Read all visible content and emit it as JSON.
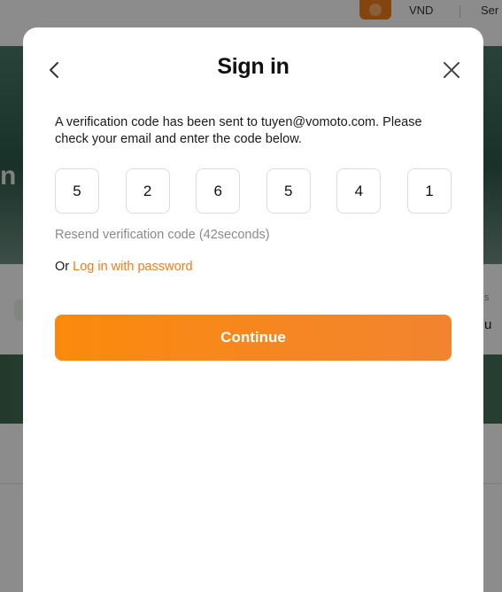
{
  "background": {
    "currency": "VND",
    "trailing_text": "Ser",
    "hero_glyph": "n",
    "right_small": "s",
    "right_text": "u"
  },
  "modal": {
    "title": "Sign in",
    "back_icon": "chevron-left-icon",
    "close_icon": "close-icon",
    "message": "A verification code has been sent to tuyen@vomoto.com. Please check your email and enter the code below.",
    "code_digits": [
      "5",
      "2",
      "6",
      "5",
      "4",
      "1"
    ],
    "resend_text": "Resend verification code (42seconds)",
    "alt_prefix": "Or ",
    "alt_link": "Log in with password",
    "continue_label": "Continue"
  },
  "colors": {
    "accent": "#f07c1a",
    "button_gradient_start": "#fb8a0c",
    "button_gradient_end": "#f28430"
  }
}
